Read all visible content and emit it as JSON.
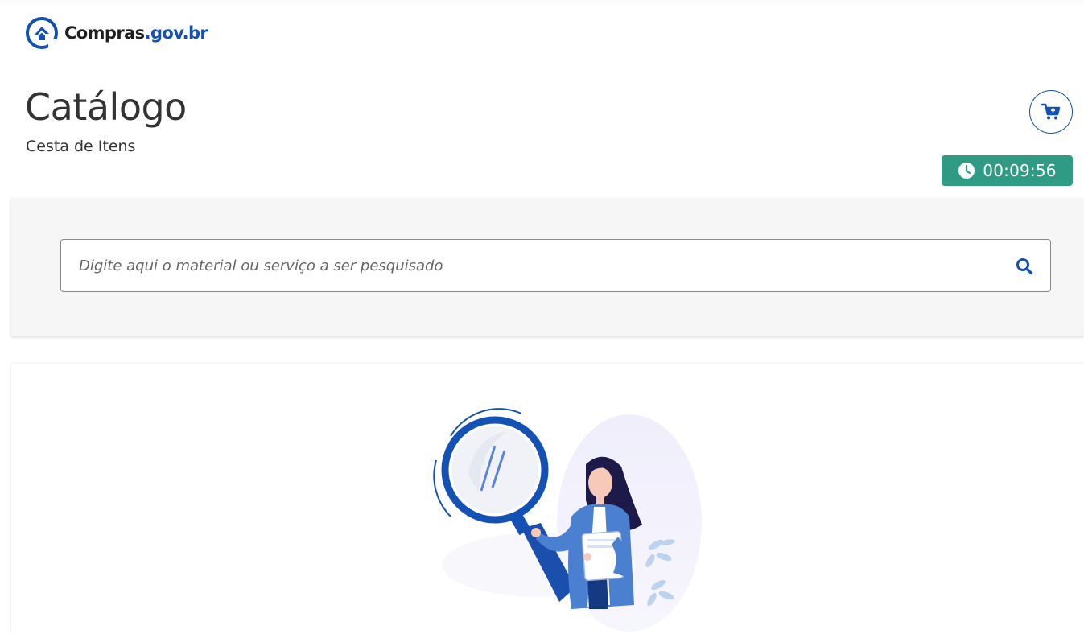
{
  "brand": {
    "name": "Compras",
    "domain": ".gov.br",
    "color": "#1351b4"
  },
  "header": {
    "title": "Catálogo",
    "subtitle": "Cesta de Itens",
    "cart_icon": "cart-plus-icon",
    "timer": {
      "value": "00:09:56",
      "icon": "clock-icon",
      "color": "#2f9b84"
    }
  },
  "search": {
    "placeholder": "Digite aqui o material ou serviço a ser pesquisado",
    "value": "",
    "icon": "search-icon"
  },
  "empty_state": {
    "illustration": "woman-with-magnifying-glass-illustration"
  }
}
